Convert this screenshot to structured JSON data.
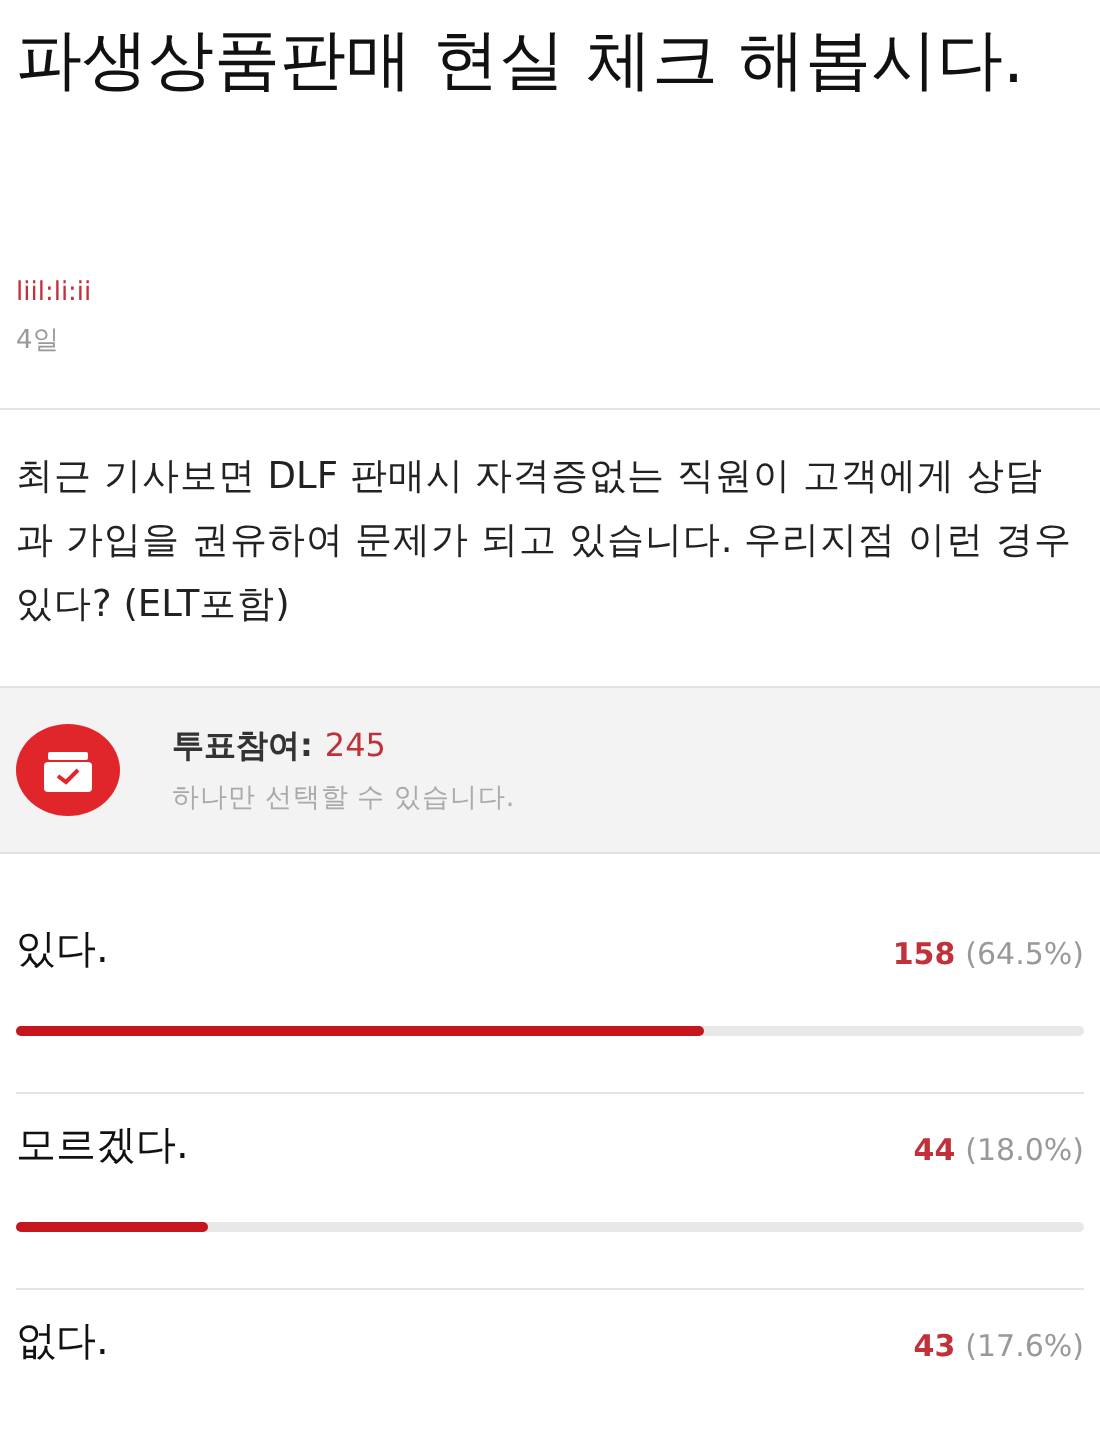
{
  "post": {
    "title": "파생상품판매 현실 체크 해봅시다.",
    "author": "liil:li:ii",
    "date": "4일",
    "body": "최근 기사보면 DLF 판매시 자격증없는 직원이 고객에게 상담과 가입을 권유하여 문제가 되고 있습니다.  우리지점 이런 경우 있다? (ELT포함)"
  },
  "poll": {
    "participation_label": "투표참여:",
    "participation_count": "245",
    "note": "하나만 선택할 수 있습니다.",
    "options": [
      {
        "label": "있다.",
        "count": "158",
        "percent": "(64.5%)",
        "level": 0.645
      },
      {
        "label": "모르겠다.",
        "count": "44",
        "percent": "(18.0%)",
        "level": 0.18
      },
      {
        "label": "없다.",
        "count": "43",
        "percent": "(17.6%)"
      }
    ]
  }
}
